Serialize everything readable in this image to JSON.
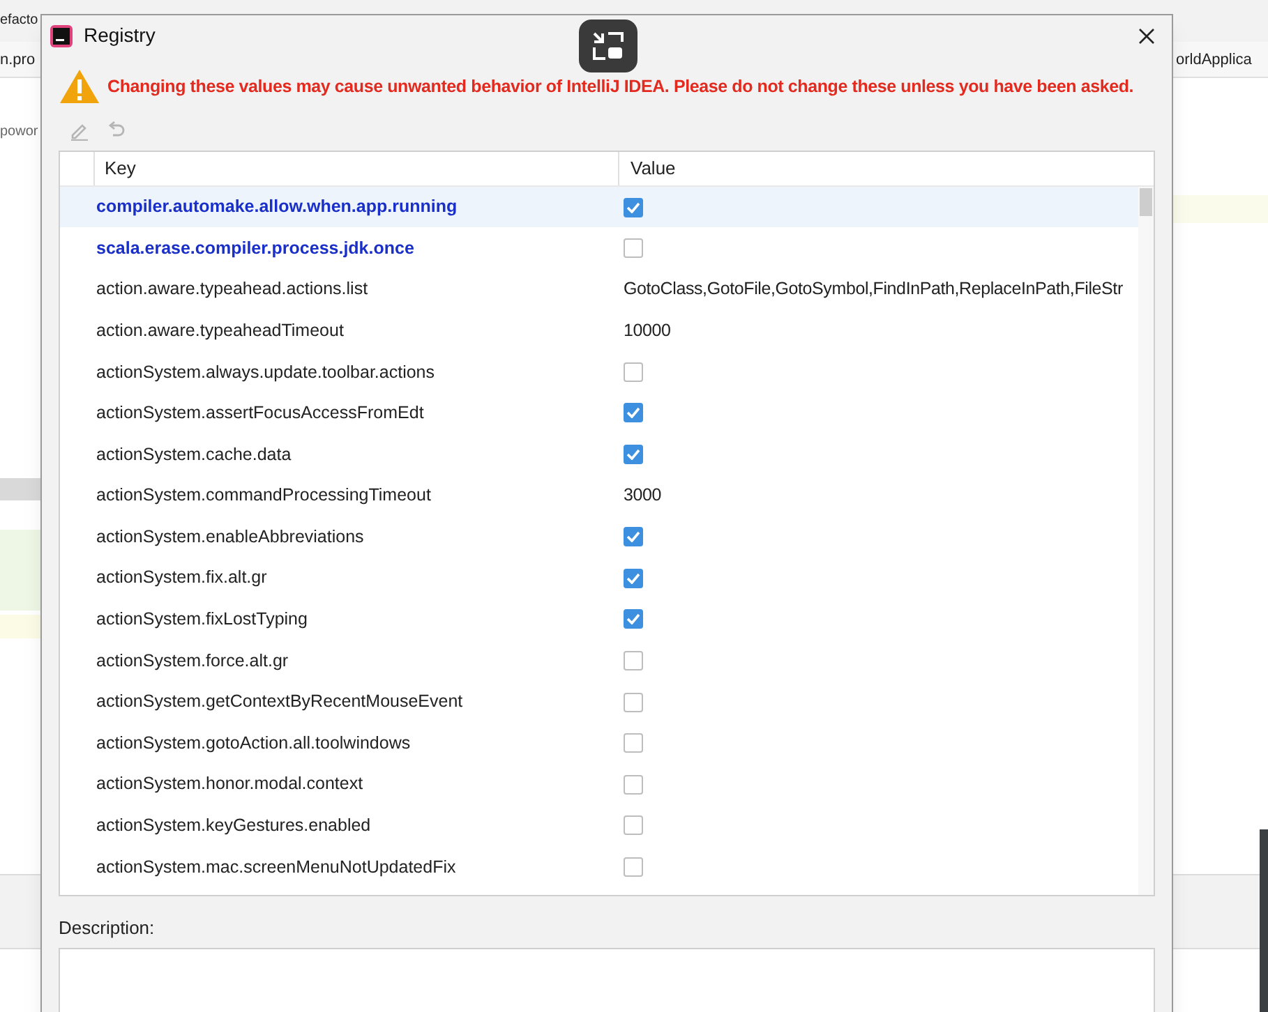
{
  "background": {
    "texts": [
      "efacto",
      "n.pro",
      "powor",
      "orldApplica"
    ]
  },
  "window": {
    "title": "Registry"
  },
  "warning": "Changing these values may cause unwanted behavior of IntelliJ IDEA. Please do not change these unless you have been asked.",
  "table": {
    "columns": [
      "Key",
      "Value"
    ],
    "rows": [
      {
        "key": "compiler.automake.allow.when.app.running",
        "kind": "checkbox",
        "checked": true,
        "modified": true,
        "selected": true
      },
      {
        "key": "scala.erase.compiler.process.jdk.once",
        "kind": "checkbox",
        "checked": false,
        "modified": true,
        "selected": false
      },
      {
        "key": "action.aware.typeahead.actions.list",
        "kind": "text",
        "value": "GotoClass,GotoFile,GotoSymbol,FindInPath,ReplaceInPath,FileStr",
        "modified": false,
        "selected": false
      },
      {
        "key": "action.aware.typeaheadTimeout",
        "kind": "text",
        "value": "10000",
        "modified": false,
        "selected": false
      },
      {
        "key": "actionSystem.always.update.toolbar.actions",
        "kind": "checkbox",
        "checked": false,
        "modified": false,
        "selected": false
      },
      {
        "key": "actionSystem.assertFocusAccessFromEdt",
        "kind": "checkbox",
        "checked": true,
        "modified": false,
        "selected": false
      },
      {
        "key": "actionSystem.cache.data",
        "kind": "checkbox",
        "checked": true,
        "modified": false,
        "selected": false
      },
      {
        "key": "actionSystem.commandProcessingTimeout",
        "kind": "text",
        "value": "3000",
        "modified": false,
        "selected": false
      },
      {
        "key": "actionSystem.enableAbbreviations",
        "kind": "checkbox",
        "checked": true,
        "modified": false,
        "selected": false
      },
      {
        "key": "actionSystem.fix.alt.gr",
        "kind": "checkbox",
        "checked": true,
        "modified": false,
        "selected": false
      },
      {
        "key": "actionSystem.fixLostTyping",
        "kind": "checkbox",
        "checked": true,
        "modified": false,
        "selected": false
      },
      {
        "key": "actionSystem.force.alt.gr",
        "kind": "checkbox",
        "checked": false,
        "modified": false,
        "selected": false
      },
      {
        "key": "actionSystem.getContextByRecentMouseEvent",
        "kind": "checkbox",
        "checked": false,
        "modified": false,
        "selected": false
      },
      {
        "key": "actionSystem.gotoAction.all.toolwindows",
        "kind": "checkbox",
        "checked": false,
        "modified": false,
        "selected": false
      },
      {
        "key": "actionSystem.honor.modal.context",
        "kind": "checkbox",
        "checked": false,
        "modified": false,
        "selected": false
      },
      {
        "key": "actionSystem.keyGestures.enabled",
        "kind": "checkbox",
        "checked": false,
        "modified": false,
        "selected": false
      },
      {
        "key": "actionSystem.mac.screenMenuNotUpdatedFix",
        "kind": "checkbox",
        "checked": false,
        "modified": false,
        "selected": false
      }
    ]
  },
  "description": {
    "label": "Description:"
  }
}
